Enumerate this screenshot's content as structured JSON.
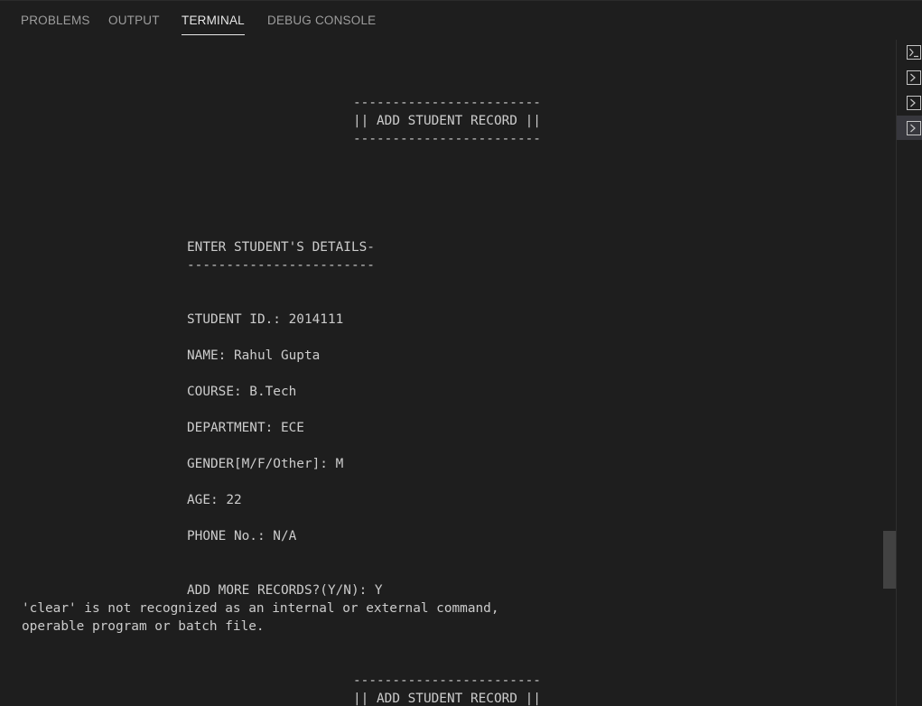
{
  "tabs": [
    {
      "label": "PROBLEMS",
      "active": false
    },
    {
      "label": "OUTPUT",
      "active": false
    },
    {
      "label": "TERMINAL",
      "active": true
    },
    {
      "label": "DEBUG CONSOLE",
      "active": false
    }
  ],
  "terminal": {
    "box_rule": "------------------------",
    "box_title": "|| ADD STUDENT RECORD ||",
    "details_heading": "ENTER STUDENT'S DETAILS-",
    "details_rule": "------------------------",
    "fields": {
      "student_id": "STUDENT ID.: 2014111",
      "name": "NAME: Rahul Gupta",
      "course": "COURSE: B.Tech",
      "department": "DEPARTMENT: ECE",
      "gender": "GENDER[M/F/Other]: M",
      "age": "AGE: 22",
      "phone": "PHONE No.: N/A"
    },
    "add_more_prompt": "ADD MORE RECORDS?(Y/N): Y",
    "error_line_1": "'clear' is not recognized as an internal or external command,",
    "error_line_2": "operable program or batch file.",
    "box_rule_2": "------------------------",
    "box_title_2": "|| ADD STUDENT RECORD ||"
  },
  "terminal_list": {
    "items": [
      {
        "icon": "terminal-icon",
        "selected": false
      },
      {
        "icon": "terminal-icon",
        "selected": false
      },
      {
        "icon": "terminal-icon",
        "selected": false
      },
      {
        "icon": "terminal-icon",
        "selected": true
      }
    ]
  },
  "colors": {
    "background": "#1e1e1e",
    "text": "#cccccc",
    "tab_inactive": "#9d9d9d",
    "tab_active": "#e7e7e7",
    "selected_item": "#37373d",
    "scroll_thumb": "#424242"
  }
}
